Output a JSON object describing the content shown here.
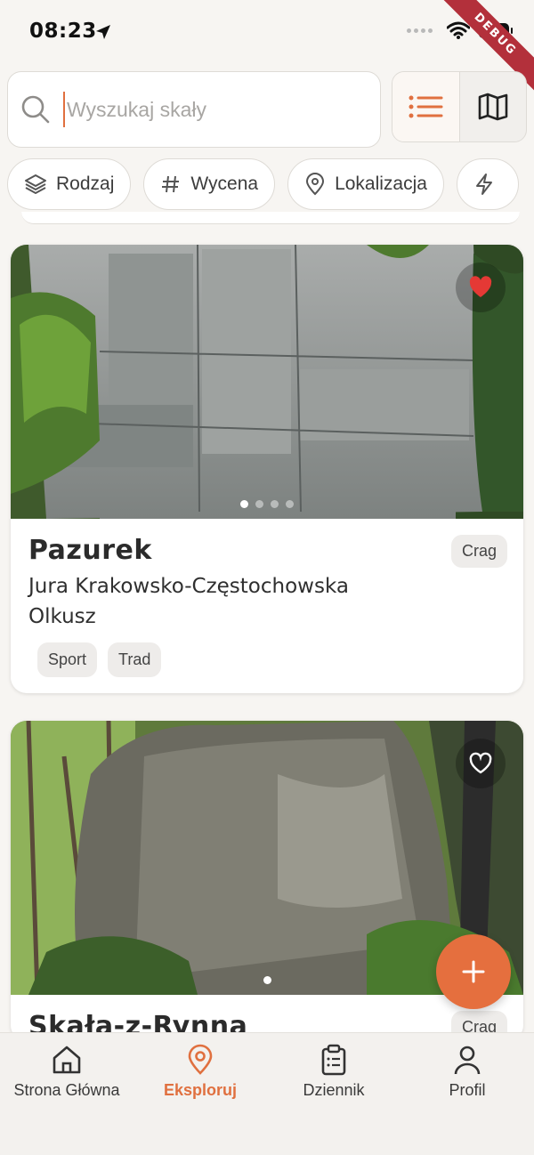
{
  "status_bar": {
    "time": "08:23"
  },
  "debug_banner": "DEBUG",
  "search": {
    "placeholder": "Wyszukaj skały"
  },
  "view_toggle": {
    "active": "list",
    "options": [
      "list-icon",
      "map-icon"
    ]
  },
  "filters": [
    {
      "label": "Rodzaj",
      "icon": "layers-icon"
    },
    {
      "label": "Wycena",
      "icon": "hash-icon"
    },
    {
      "label": "Lokalizacja",
      "icon": "location-pin-icon"
    },
    {
      "label": "",
      "icon": "lightning-icon"
    }
  ],
  "cards": [
    {
      "name": "Pazurek",
      "type": "Crag",
      "region": "Jura Krakowsko-Częstochowska",
      "area": "Olkusz",
      "tags": [
        "Sport",
        "Trad"
      ],
      "favorite": true,
      "image_count": 4,
      "image_index": 0
    },
    {
      "name": "Skała-z-Rynną",
      "type": "Crag",
      "region": "",
      "area": "",
      "tags": [],
      "favorite": false,
      "image_count": 1,
      "image_index": 0
    }
  ],
  "fab_icon": "plus-icon",
  "bottom_nav": {
    "active": "explore",
    "items": [
      {
        "id": "home",
        "label": "Strona Główna",
        "icon": "home-icon"
      },
      {
        "id": "explore",
        "label": "Eksploruj",
        "icon": "location-pin-icon"
      },
      {
        "id": "journal",
        "label": "Dziennik",
        "icon": "clipboard-icon"
      },
      {
        "id": "profile",
        "label": "Profil",
        "icon": "user-icon"
      }
    ]
  },
  "colors": {
    "accent": "#E56F3E",
    "background": "#F7F5F2",
    "favorite": "#E53935"
  }
}
